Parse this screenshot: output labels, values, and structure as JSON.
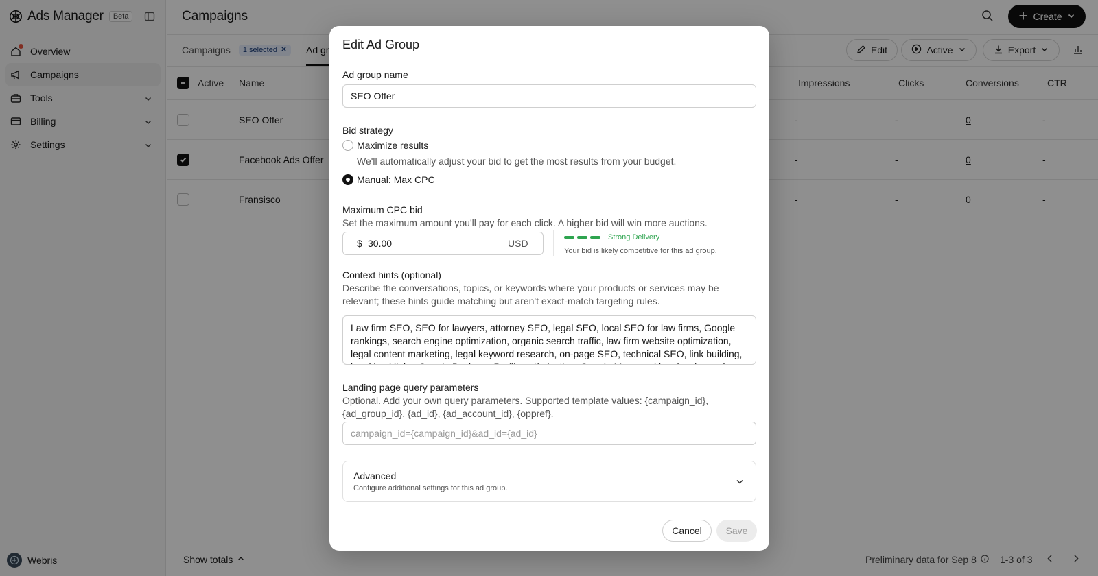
{
  "app": {
    "name": "Ads Manager",
    "badge": "Beta"
  },
  "sidebar": {
    "items": [
      {
        "label": "Overview",
        "icon": "home-icon"
      },
      {
        "label": "Campaigns",
        "icon": "megaphone-icon"
      },
      {
        "label": "Tools",
        "icon": "toolbox-icon"
      },
      {
        "label": "Billing",
        "icon": "credit-card-icon"
      },
      {
        "label": "Settings",
        "icon": "gear-icon"
      }
    ],
    "user": "Webris"
  },
  "header": {
    "title": "Campaigns",
    "create_label": "Create"
  },
  "tabs": {
    "campaigns": "Campaigns",
    "selected_chip": "1 selected",
    "ad_groups": "Ad groups"
  },
  "actions": {
    "edit": "Edit",
    "status": "Active",
    "export": "Export"
  },
  "table": {
    "columns": {
      "active": "Active",
      "name": "Name",
      "impressions": "Impressions",
      "clicks": "Clicks",
      "conversions": "Conversions",
      "ctr": "CTR"
    },
    "rows": [
      {
        "name": "SEO Offer",
        "checked": false,
        "active": true,
        "impressions": "-",
        "clicks": "-",
        "conversions": "0",
        "ctr": "-"
      },
      {
        "name": "Facebook Ads Offer",
        "checked": true,
        "active": true,
        "impressions": "-",
        "clicks": "-",
        "conversions": "0",
        "ctr": "-"
      },
      {
        "name": "Fransisco",
        "checked": false,
        "active": true,
        "impressions": "-",
        "clicks": "-",
        "conversions": "0",
        "ctr": "-"
      }
    ]
  },
  "footer": {
    "show_totals": "Show totals",
    "preliminary": "Preliminary data for Sep 8",
    "range": "1-3 of 3"
  },
  "modal": {
    "title": "Edit Ad Group",
    "name_label": "Ad group name",
    "name_value": "SEO Offer",
    "bid_label": "Bid strategy",
    "opt_max": "Maximize results",
    "opt_max_desc": "We'll automatically adjust your bid to get the most results from your budget.",
    "opt_manual": "Manual: Max CPC",
    "selected_option": "Manual: Max CPC",
    "cpc_label": "Maximum CPC bid",
    "cpc_desc": "Set the maximum amount you'll pay for each click. A higher bid will win more auctions.",
    "currency_symbol": "$",
    "cpc_value": "30.00",
    "currency": "USD",
    "delivery_level": 3,
    "delivery_status": "Strong Delivery",
    "delivery_hint": "Your bid is likely competitive for this ad group.",
    "context_label": "Context hints (optional)",
    "context_desc": "Describe the conversations, topics, or keywords where your products or services may be relevant; these hints guide matching but aren't exact-match targeting rules.",
    "context_value": "Law firm SEO, SEO for lawyers, attorney SEO, legal SEO, local SEO for law firms, Google rankings, search engine optimization, organic search traffic, law firm website optimization, legal content marketing, legal keyword research, on-page SEO, technical SEO, link building, legal backlinks, Google Business Profile optimization, Google Maps ranking, local search visibility, law firm website",
    "landing_label": "Landing page query parameters",
    "landing_desc": "Optional. Add your own query parameters. Supported template values: {campaign_id}, {ad_group_id}, {ad_id}, {ad_account_id}, {oppref}.",
    "landing_placeholder": "campaign_id={campaign_id}&ad_id={ad_id}",
    "advanced_title": "Advanced",
    "advanced_desc": "Configure additional settings for this ad group.",
    "cancel": "Cancel",
    "save": "Save"
  }
}
